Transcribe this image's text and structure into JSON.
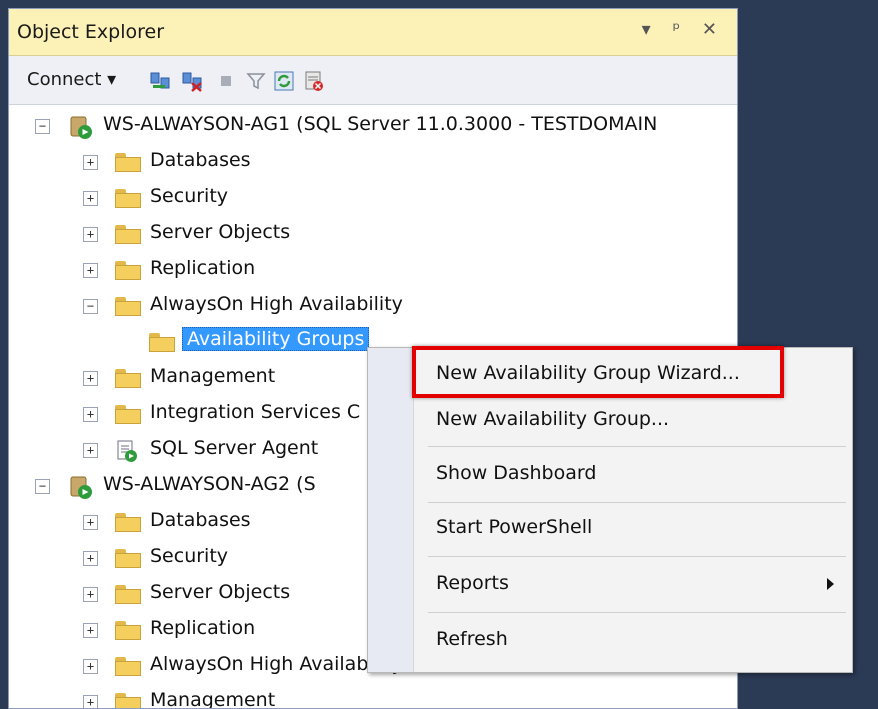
{
  "panel": {
    "title": "Object Explorer",
    "controls": "▾ ᵖ ✕"
  },
  "toolbar": {
    "connect_label": "Connect ▾",
    "icons": [
      "connect-object-explorer-icon",
      "disconnect-icon",
      "stop-icon",
      "filter-icon",
      "refresh-icon",
      "activity-monitor-icon"
    ]
  },
  "tree": {
    "server1": {
      "label": "WS-ALWAYSON-AG1 (SQL Server 11.0.3000 - TESTDOMAIN",
      "children": [
        "Databases",
        "Security",
        "Server Objects",
        "Replication",
        "AlwaysOn High Availability",
        "Management",
        "Integration Services C",
        "SQL Server Agent"
      ],
      "ao_child": "Availability Groups"
    },
    "server2": {
      "label": "WS-ALWAYSON-AG2 (S",
      "children": [
        "Databases",
        "Security",
        "Server Objects",
        "Replication",
        "AlwaysOn High Availability",
        "Management"
      ]
    }
  },
  "context_menu": {
    "items": [
      "New Availability Group Wizard...",
      "New Availability Group...",
      "Show Dashboard",
      "Start PowerShell",
      "Reports",
      "Refresh"
    ]
  },
  "colors": {
    "accent_highlight": "#e30000",
    "selection": "#3399ff",
    "title_bar": "#fcf2b8"
  }
}
